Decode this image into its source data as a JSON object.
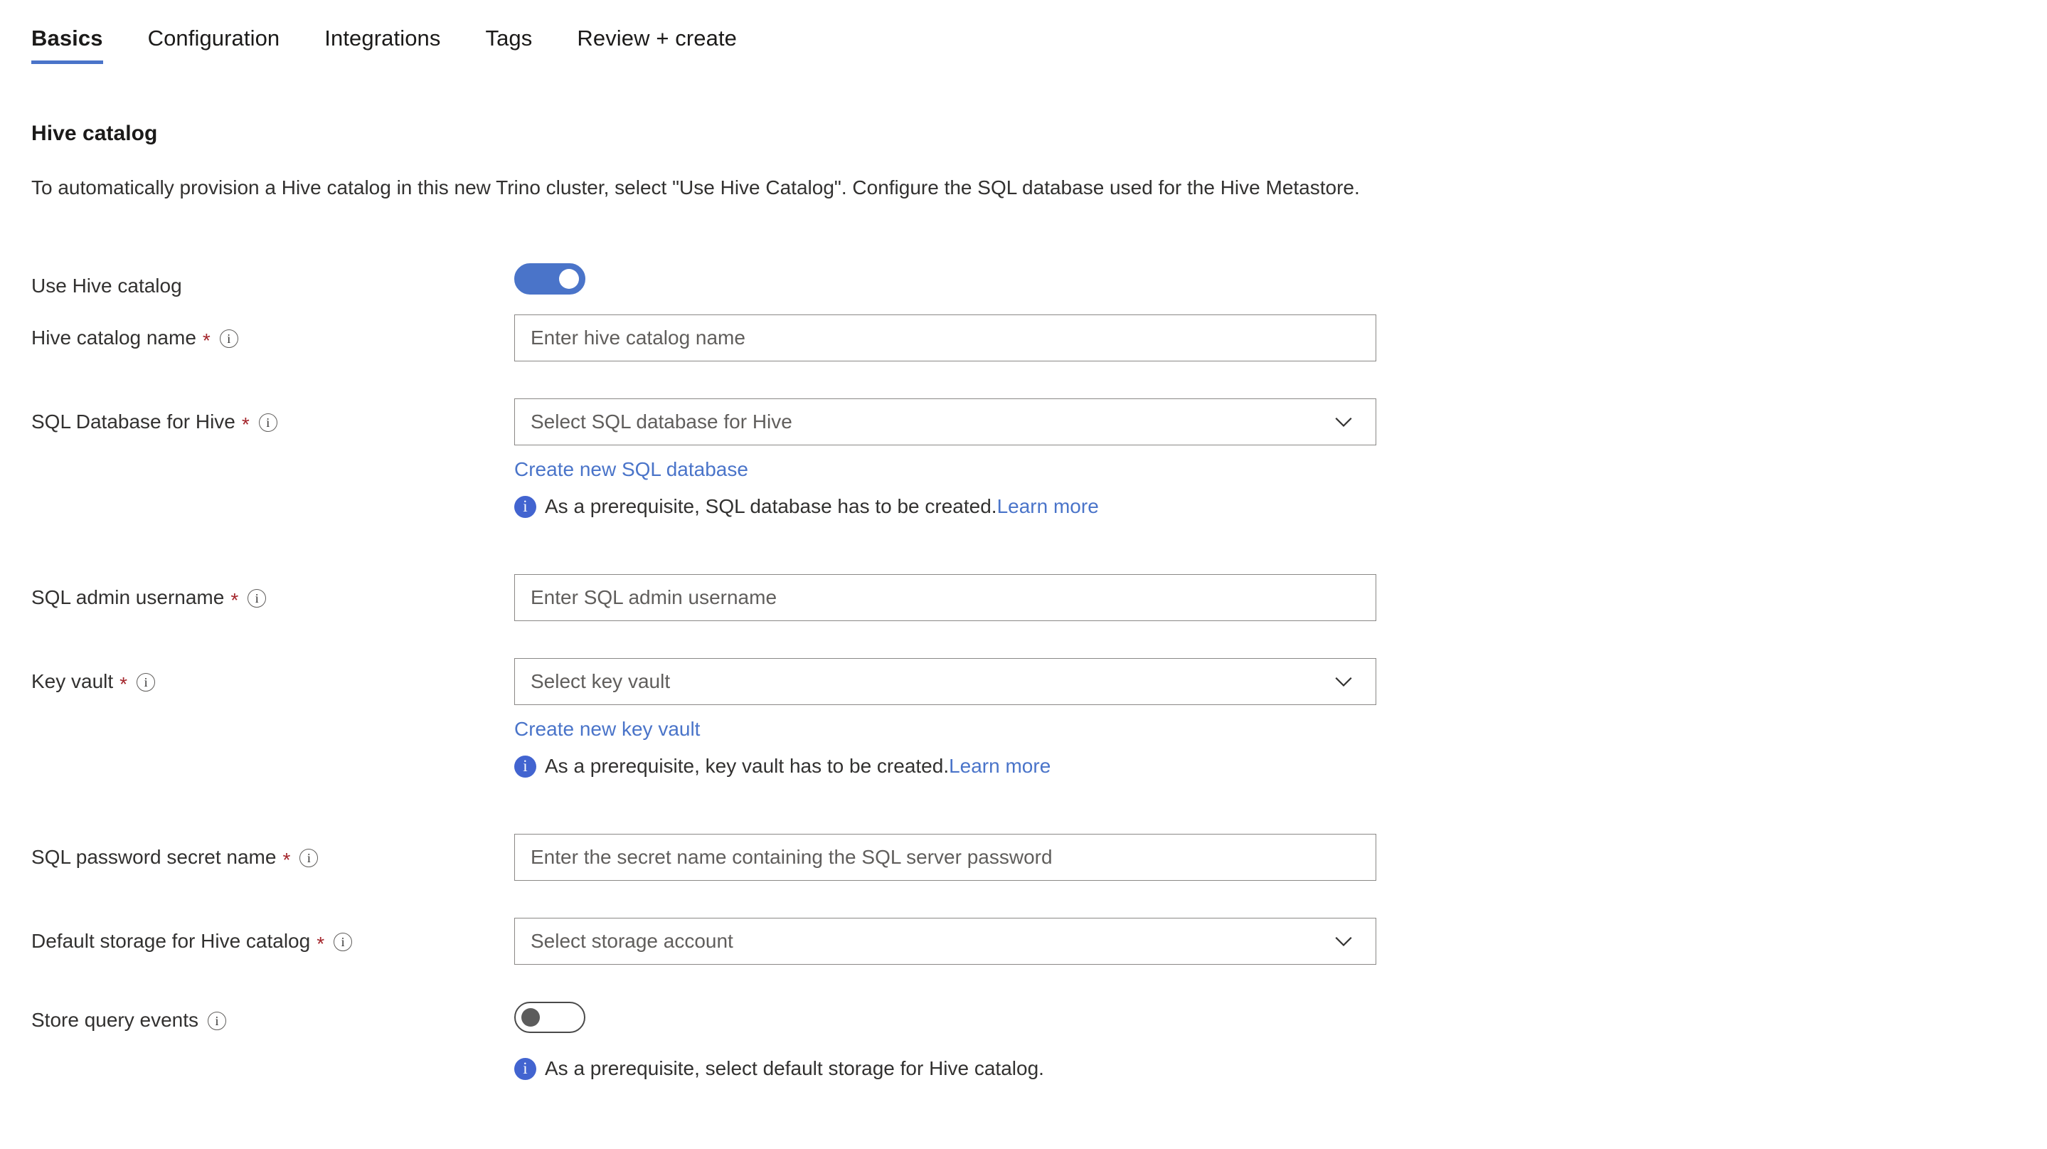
{
  "tabs": [
    {
      "label": "Basics",
      "active": true
    },
    {
      "label": "Configuration",
      "active": false
    },
    {
      "label": "Integrations",
      "active": false
    },
    {
      "label": "Tags",
      "active": false
    },
    {
      "label": "Review + create",
      "active": false
    }
  ],
  "section": {
    "title": "Hive catalog",
    "description": "To automatically provision a Hive catalog in this new Trino cluster, select \"Use Hive Catalog\". Configure the SQL database used for the Hive Metastore."
  },
  "fields": {
    "use_hive_catalog": {
      "label": "Use Hive catalog",
      "toggle_state": "on"
    },
    "hive_catalog_name": {
      "label": "Hive catalog name",
      "required": "*",
      "info_icon": "info-circle-icon",
      "placeholder": "Enter hive catalog name",
      "value": ""
    },
    "sql_database_for_hive": {
      "label": "SQL Database for Hive",
      "required": "*",
      "info_icon": "info-circle-icon",
      "placeholder": "Select SQL database for Hive",
      "value": "",
      "chevron_icon": "chevron-down-icon",
      "create_link": "Create new SQL database",
      "info_message": "As a prerequisite, SQL database has to be created.",
      "learn_more": "Learn more"
    },
    "sql_admin_username": {
      "label": "SQL admin username",
      "required": "*",
      "info_icon": "info-circle-icon",
      "placeholder": "Enter SQL admin username",
      "value": ""
    },
    "key_vault": {
      "label": "Key vault",
      "required": "*",
      "info_icon": "info-circle-icon",
      "placeholder": "Select key vault",
      "value": "",
      "chevron_icon": "chevron-down-icon",
      "create_link": "Create new key vault",
      "info_message": "As a prerequisite, key vault has to be created.",
      "learn_more": "Learn more"
    },
    "sql_password_secret_name": {
      "label": "SQL password secret name",
      "required": "*",
      "info_icon": "info-circle-icon",
      "placeholder": "Enter the secret name containing the SQL server password",
      "value": ""
    },
    "default_storage_for_hive_catalog": {
      "label": "Default storage for Hive catalog",
      "required": "*",
      "info_icon": "info-circle-icon",
      "placeholder": "Select storage account",
      "value": "",
      "chevron_icon": "chevron-down-icon"
    },
    "store_query_events": {
      "label": "Store query events",
      "info_icon": "info-circle-icon",
      "toggle_state": "off",
      "info_message": "As a prerequisite, select default storage for Hive catalog."
    }
  },
  "colors": {
    "accent_blue": "#4a74c9",
    "info_blue": "#4264d0",
    "required_red": "#a4262c",
    "border_gray": "#8a8886",
    "text": "#323130"
  }
}
